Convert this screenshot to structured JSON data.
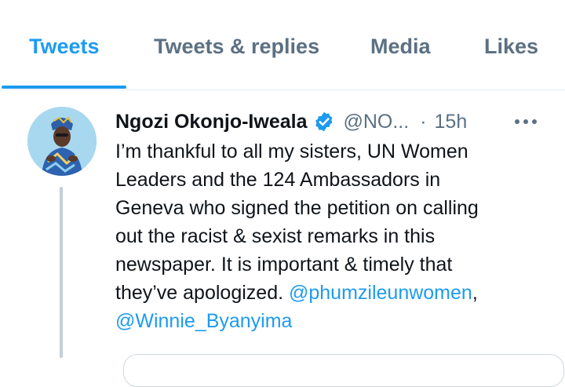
{
  "tabs": [
    {
      "label": "Tweets",
      "active": true
    },
    {
      "label": "Tweets & replies",
      "active": false
    },
    {
      "label": "Media",
      "active": false
    },
    {
      "label": "Likes",
      "active": false
    }
  ],
  "tweet": {
    "author_name": "Ngozi Okonjo-Iweala",
    "handle": "@NO...",
    "separator": "·",
    "time": "15h",
    "verified_icon": "verified-badge-icon",
    "more_icon": "more-options-icon",
    "text_lines": [
      "I’m thankful to all my sisters, UN Women",
      "Leaders and the 124 Ambassadors in",
      "Geneva who signed the petition on calling",
      "out the racist & sexist remarks in this",
      "newspaper. It is important & timely that",
      "they’ve apologized. "
    ],
    "mention_1": "@phumzileunwomen",
    "mention_sep": ",",
    "mention_2": "@Winnie_Byanyima"
  },
  "colors": {
    "accent": "#1d9bf0",
    "tab_inactive": "#5b7083",
    "text": "#0f1419",
    "thread_line": "#c4cfd6"
  }
}
